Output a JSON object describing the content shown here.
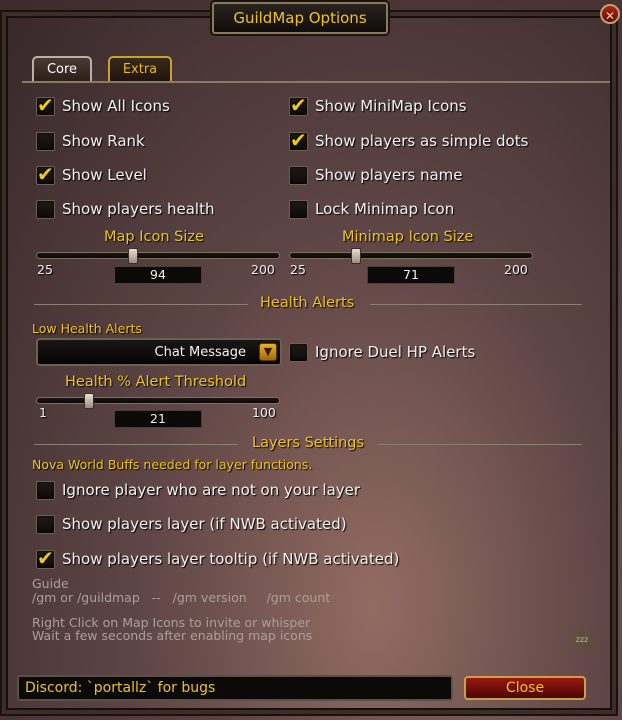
{
  "window": {
    "title": "GuildMap Options",
    "close_glyph": "✕"
  },
  "tabs": [
    {
      "label": "Core",
      "active": true
    },
    {
      "label": "Extra",
      "active": false
    }
  ],
  "checkboxes": {
    "show_all_icons": {
      "label": "Show All Icons",
      "checked": true
    },
    "show_rank": {
      "label": "Show Rank",
      "checked": false
    },
    "show_level": {
      "label": "Show Level",
      "checked": true
    },
    "show_players_health": {
      "label": "Show players health",
      "checked": false
    },
    "show_minimap_icons": {
      "label": "Show MiniMap Icons",
      "checked": true
    },
    "show_players_simple_dots": {
      "label": "Show players as simple dots",
      "checked": true
    },
    "show_players_name": {
      "label": "Show players name",
      "checked": false
    },
    "lock_minimap_icon": {
      "label": "Lock Minimap Icon",
      "checked": false
    },
    "ignore_duel_hp": {
      "label": "Ignore Duel HP Alerts",
      "checked": false
    },
    "ignore_not_on_layer": {
      "label": "Ignore player who are not on your layer",
      "checked": false
    },
    "show_players_layer": {
      "label": "Show players layer (if NWB activated)",
      "checked": false
    },
    "show_players_layer_tooltip": {
      "label": "Show players layer tooltip (if NWB activated)",
      "checked": true
    }
  },
  "check_glyph": "✔",
  "sliders": {
    "map_icon_size": {
      "title": "Map Icon Size",
      "min": 25,
      "max": 200,
      "value": 94,
      "min_label": "25",
      "max_label": "200",
      "value_label": "94"
    },
    "minimap_icon_size": {
      "title": "Minimap Icon Size",
      "min": 25,
      "max": 200,
      "value": 71,
      "min_label": "25",
      "max_label": "200",
      "value_label": "71"
    },
    "health_threshold": {
      "title": "Health % Alert Threshold",
      "min": 1,
      "max": 100,
      "value": 21,
      "min_label": "1",
      "max_label": "100",
      "value_label": "21"
    }
  },
  "sections": {
    "health_alerts": "Health Alerts",
    "layers_settings": "Layers Settings"
  },
  "low_health_label": "Low Health Alerts",
  "dropdown": {
    "selected": "Chat Message",
    "arrow_glyph": "▼"
  },
  "nwb_note": "Nova World Buffs needed for layer functions.",
  "guide": {
    "title": "Guide",
    "commands": "/gm or /guildmap   --   /gm version     /gm count",
    "line1": "Right Click on Map Icons to invite or whisper",
    "line2": "Wait a few seconds after enabling map icons"
  },
  "footer": {
    "discord_text": "Discord: `portallz` for bugs",
    "close_label": "Close"
  },
  "colors": {
    "gold": "#f0c419",
    "close_red": "#9a1810"
  },
  "corner_badge_text": "zzz"
}
